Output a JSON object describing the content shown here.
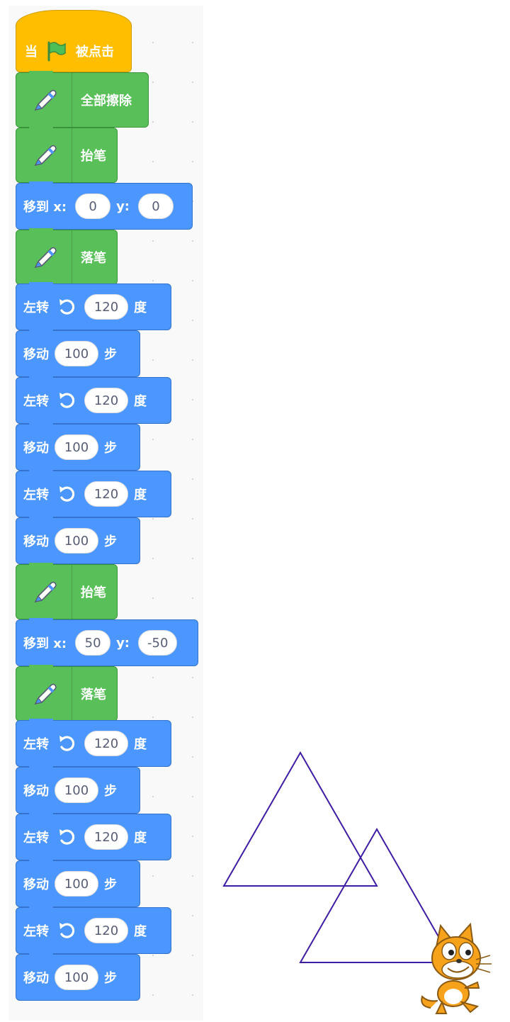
{
  "script": {
    "hat": {
      "prefix": "当",
      "suffix": "被点击"
    },
    "blocks": [
      {
        "type": "pen",
        "label": "全部擦除"
      },
      {
        "type": "pen",
        "label": "抬笔"
      },
      {
        "type": "goto",
        "label": "移到 x:",
        "x": "0",
        "y_label": "y:",
        "y": "0"
      },
      {
        "type": "pen",
        "label": "落笔"
      },
      {
        "type": "turn",
        "label": "左转",
        "degrees": "120",
        "unit": "度"
      },
      {
        "type": "move",
        "label": "移动",
        "steps": "100",
        "unit": "步"
      },
      {
        "type": "turn",
        "label": "左转",
        "degrees": "120",
        "unit": "度"
      },
      {
        "type": "move",
        "label": "移动",
        "steps": "100",
        "unit": "步"
      },
      {
        "type": "turn",
        "label": "左转",
        "degrees": "120",
        "unit": "度"
      },
      {
        "type": "move",
        "label": "移动",
        "steps": "100",
        "unit": "步"
      },
      {
        "type": "pen",
        "label": "抬笔"
      },
      {
        "type": "goto",
        "label": "移到 x:",
        "x": "50",
        "y_label": "y:",
        "y": "-50"
      },
      {
        "type": "pen",
        "label": "落笔"
      },
      {
        "type": "turn",
        "label": "左转",
        "degrees": "120",
        "unit": "度"
      },
      {
        "type": "move",
        "label": "移动",
        "steps": "100",
        "unit": "步"
      },
      {
        "type": "turn",
        "label": "左转",
        "degrees": "120",
        "unit": "度"
      },
      {
        "type": "move",
        "label": "移动",
        "steps": "100",
        "unit": "步"
      },
      {
        "type": "turn",
        "label": "左转",
        "degrees": "120",
        "unit": "度"
      },
      {
        "type": "move",
        "label": "移动",
        "steps": "100",
        "unit": "步"
      }
    ]
  },
  "colors": {
    "motion": "#4c97ff",
    "pen": "#59c059",
    "event": "#ffbf00",
    "pen_line": "#3f1da3",
    "flag": "#4cbf56"
  },
  "icons": {
    "hat": "green-flag-icon",
    "pen": "pen-icon",
    "turn": "rotate-left-icon",
    "sprite": "scratch-cat-sprite"
  }
}
